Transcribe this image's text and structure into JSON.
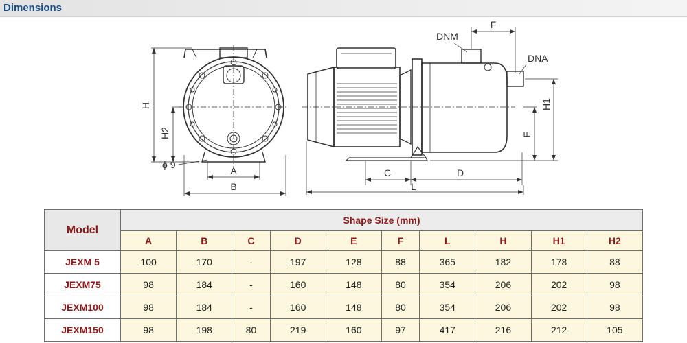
{
  "header": {
    "title": "Dimensions"
  },
  "drawing": {
    "labels": {
      "H": "H",
      "H2": "H2",
      "phi9": "ϕ 9",
      "A": "A",
      "B": "B",
      "DNM": "DNM",
      "F": "F",
      "DNA": "DNA",
      "E": "E",
      "H1": "H1",
      "C": "C",
      "D": "D",
      "L": "L"
    }
  },
  "table": {
    "model_header": "Model",
    "group_header": "Shape Size (mm)",
    "columns": [
      "A",
      "B",
      "C",
      "D",
      "E",
      "F",
      "L",
      "H",
      "H1",
      "H2"
    ],
    "rows": [
      {
        "model": "JEXM 5",
        "values": [
          "100",
          "170",
          "-",
          "197",
          "128",
          "88",
          "365",
          "182",
          "178",
          "88"
        ]
      },
      {
        "model": "JEXM75",
        "values": [
          "98",
          "184",
          "-",
          "160",
          "148",
          "80",
          "354",
          "206",
          "202",
          "98"
        ]
      },
      {
        "model": "JEXM100",
        "values": [
          "98",
          "184",
          "-",
          "160",
          "148",
          "80",
          "354",
          "206",
          "202",
          "98"
        ]
      },
      {
        "model": "JEXM150",
        "values": [
          "98",
          "198",
          "80",
          "219",
          "160",
          "97",
          "417",
          "216",
          "212",
          "105"
        ]
      }
    ]
  }
}
